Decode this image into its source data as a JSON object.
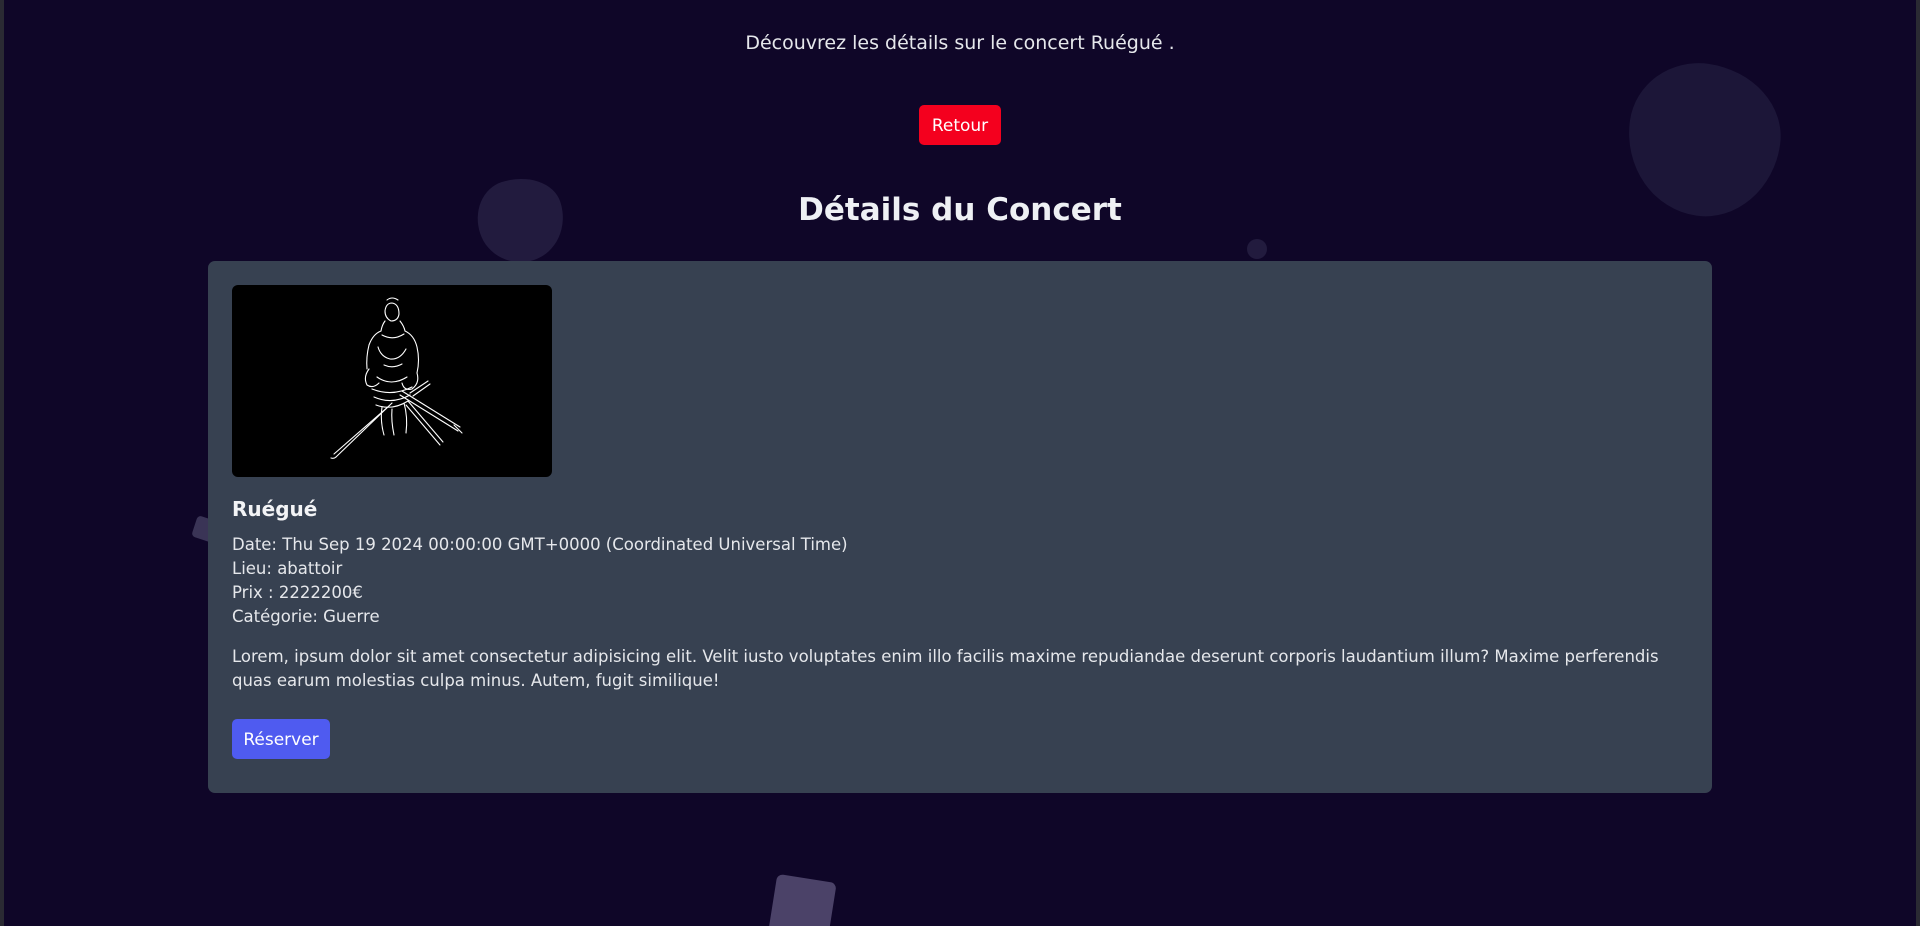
{
  "header": {
    "intro_text": "Découvrez les détails sur le concert Ruégué ."
  },
  "navigation": {
    "back_label": "Retour"
  },
  "page": {
    "title": "Détails du Concert"
  },
  "concert": {
    "name": "Ruégué",
    "date_line": "Date: Thu Sep 19 2024 00:00:00 GMT+0000 (Coordinated Universal Time)",
    "lieu_line": "Lieu: abattoir",
    "prix_line": "Prix : 2222200€",
    "categorie_line": "Catégorie: Guerre",
    "description": "Lorem, ipsum dolor sit amet consectetur adipisicing elit. Velit iusto voluptates enim illo facilis maxime repudiandae deserunt corporis laudantium illum? Maxime perferendis quas earum molestias culpa minus. Autem, fugit similique!",
    "image": "samurai-swordsman-sketch",
    "reserve_label": "Réserver"
  },
  "colors": {
    "background": "#0f0628",
    "card": "#374151",
    "back_button": "#f4001e",
    "reserve_button": "#4f5bf0"
  }
}
